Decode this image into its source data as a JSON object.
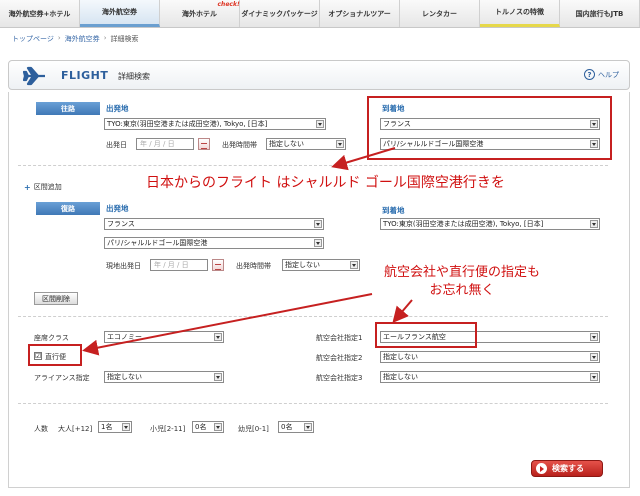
{
  "nav": {
    "tabs": [
      {
        "label": "海外航空券+ホテル"
      },
      {
        "label": "海外航空券"
      },
      {
        "label": "海外ホテル",
        "badge": "check!"
      },
      {
        "label": "ダイナミックパッケージ"
      },
      {
        "label": "オプショナルツアー"
      },
      {
        "label": "レンタカー"
      },
      {
        "label": "トルノスの特徴"
      },
      {
        "label": "国内旅行もJTB"
      }
    ]
  },
  "breadcrumb": {
    "top": "トップページ",
    "flights": "海外航空券",
    "current": "詳細検索"
  },
  "header": {
    "title": "FLIGHT",
    "subtitle": "詳細検索",
    "help": "ヘルプ"
  },
  "outbound": {
    "segment_label": "往路",
    "from_label": "出発地",
    "from_value": "TYO:東京(羽田空港または成田空港), Tokyo, [日本]",
    "date_label": "出発日",
    "date_placeholder": "年 / 月 / 日",
    "time_label": "出発時間帯",
    "time_value": "指定しない",
    "to_label": "到着地",
    "to_country": "フランス",
    "to_airport": "パリ/シャルルドゴール国際空港"
  },
  "add_segment": "区間追加",
  "return": {
    "segment_label": "復路",
    "from_label": "出発地",
    "from_country": "フランス",
    "from_airport": "パリ/シャルルドゴール国際空港",
    "date_label": "現地出発日",
    "date_placeholder": "年 / 月 / 日",
    "time_label": "出発時間帯",
    "time_value": "指定しない",
    "to_label": "到着地",
    "to_value": "TYO:東京(羽田空港または成田空港), Tokyo, [日本]"
  },
  "delete_segment": "区間削除",
  "options": {
    "class_label": "座席クラス",
    "class_value": "エコノミー",
    "direct_label": "直行便",
    "direct_checked": "☑",
    "alliance_label": "アライアンス指定",
    "alliance_value": "指定しない",
    "airline1_label": "航空会社指定1",
    "airline1_value": "エールフランス航空",
    "airline2_label": "航空会社指定2",
    "airline2_value": "指定しない",
    "airline3_label": "航空会社指定3",
    "airline3_value": "指定しない"
  },
  "passengers": {
    "label": "人数",
    "adult_label": "大人[+12]",
    "adult_value": "1名",
    "child_label": "小児[2-11]",
    "child_value": "0名",
    "infant_label": "幼児[0-1]",
    "infant_value": "0名"
  },
  "search_button": "検索する",
  "annotations": {
    "note1": "日本からのフライト はシャルルド ゴール国際空港行きを",
    "note2_line1": "航空会社や直行便の指定も",
    "note2_line2": "お忘れ無く"
  },
  "colors": {
    "accent": "#2d6fb0",
    "annotation": "#d01010",
    "search": "#c22a22"
  }
}
